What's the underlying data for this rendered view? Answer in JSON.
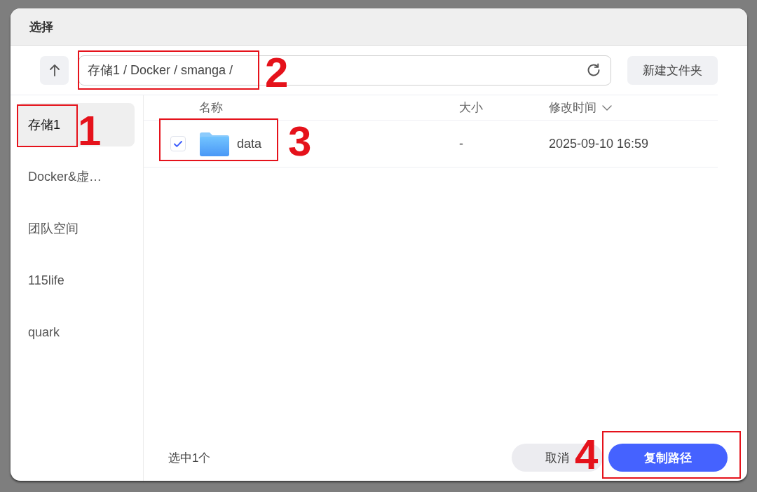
{
  "dialog": {
    "title": "选择"
  },
  "toolbar": {
    "path": "存储1 / Docker / smanga /",
    "new_folder_button": "新建文件夹"
  },
  "sidebar": {
    "items": [
      {
        "label": "存储1",
        "selected": true
      },
      {
        "label": "Docker&虚…",
        "selected": false
      },
      {
        "label": "团队空间",
        "selected": false
      },
      {
        "label": "115life",
        "selected": false
      },
      {
        "label": "quark",
        "selected": false
      }
    ]
  },
  "table": {
    "columns": [
      {
        "label": "名称",
        "sorted": false
      },
      {
        "label": "大小",
        "sorted": false
      },
      {
        "label": "修改时间",
        "sorted": true
      }
    ],
    "rows": [
      {
        "kind": "folder",
        "name": "data",
        "size": "-",
        "modified": "2025-09-10 16:59",
        "checked": true
      }
    ]
  },
  "footer": {
    "selection_text": "选中1个",
    "buttons": [
      {
        "label": "取消",
        "kind": "secondary"
      },
      {
        "label": "复制路径",
        "kind": "primary"
      }
    ]
  },
  "annotations": [
    {
      "label": "1"
    },
    {
      "label": "2"
    },
    {
      "label": "3"
    },
    {
      "label": "4"
    }
  ]
}
